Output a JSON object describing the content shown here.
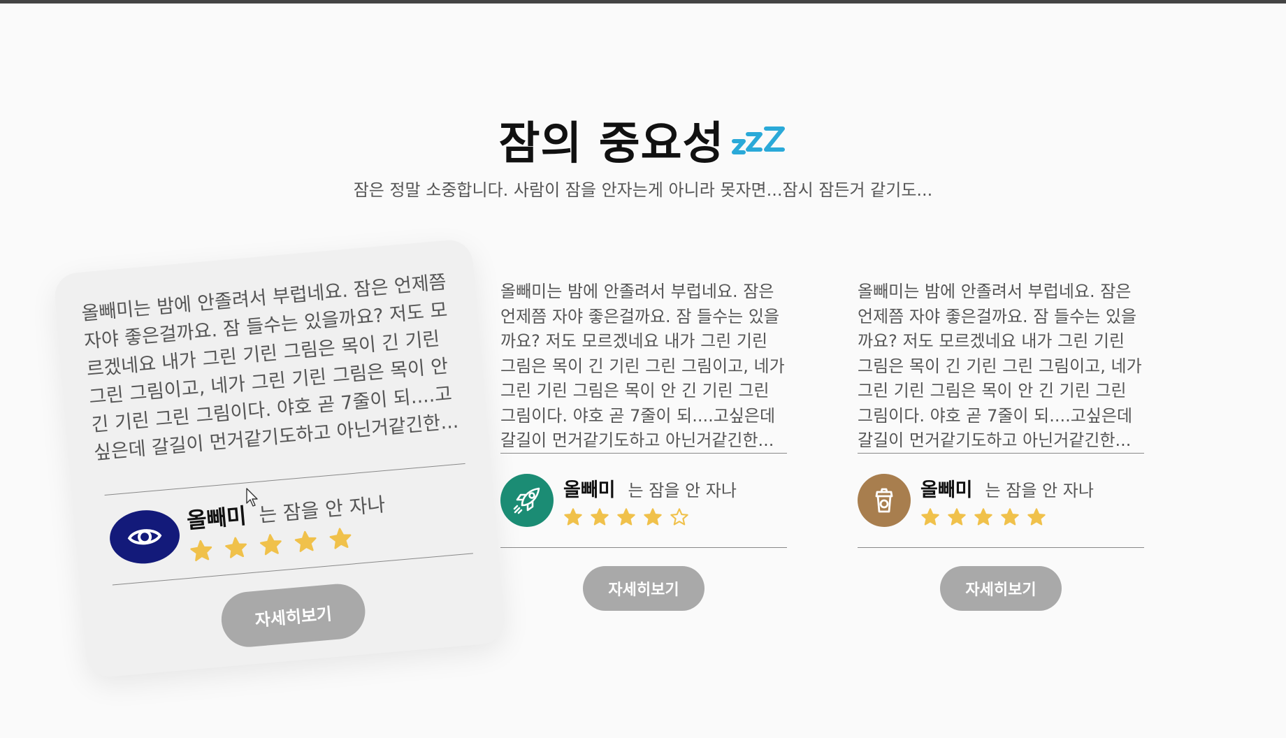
{
  "header": {
    "title": "잠의 중요성",
    "title_icon": "zzz-icon",
    "subtitle": "잠은 정말 소중합니다. 사람이 잠을 안자는게 아니라 못자면...잠시 잠든거 같기도..."
  },
  "colors": {
    "star": "#f0c14b",
    "button": "#a9a9a9",
    "zzz": "#2aa9d8"
  },
  "cards": [
    {
      "text": "올빼미는 밤에 안졸려서 부럽네요. 잠은 언제쯤 자야 좋은걸까요. 잠 들수는 있을까요? 저도 모르겠네요 내가 그린 기린 그림은 목이 긴 기린 그린 그림이고, 네가 그린 기린 그림은 목이 안 긴 기린 그린 그림이다. 야호 곧 7줄이 되....고싶은데 갈길이 먼거같기도하고 아닌거같긴한...",
      "name": "올빼미",
      "tag": "는 잠을 안 자나",
      "icon": "eye-icon",
      "avatar_color": "#131a7a",
      "rating": 5,
      "button": "자세히보기"
    },
    {
      "text": "올빼미는 밤에 안졸려서 부럽네요. 잠은 언제쯤 자야 좋은걸까요. 잠 들수는 있을까요? 저도 모르겠네요 내가 그린 기린 그림은 목이 긴 기린 그린 그림이고, 네가 그린 기린 그림은 목이 안 긴 기린 그린 그림이다. 야호 곧 7줄이 되....고싶은데 갈길이 먼거같기도하고 아닌거같긴한...",
      "name": "올빼미",
      "tag": "는 잠을 안 자나",
      "icon": "rocket-icon",
      "avatar_color": "#1b8c74",
      "rating": 4,
      "button": "자세히보기"
    },
    {
      "text": "올빼미는 밤에 안졸려서 부럽네요. 잠은 언제쯤 자야 좋은걸까요. 잠 들수는 있을까요? 저도 모르겠네요 내가 그린 기린 그림은 목이 긴 기린 그린 그림이고, 네가 그린 기린 그림은 목이 안 긴 기린 그린 그림이다. 야호 곧 7줄이 되....고싶은데 갈길이 먼거같기도하고 아닌거같긴한...",
      "name": "올빼미",
      "tag": "는 잠을 안 자나",
      "icon": "coffee-cup-icon",
      "avatar_color": "#a87e4e",
      "rating": 5,
      "button": "자세히보기"
    }
  ]
}
